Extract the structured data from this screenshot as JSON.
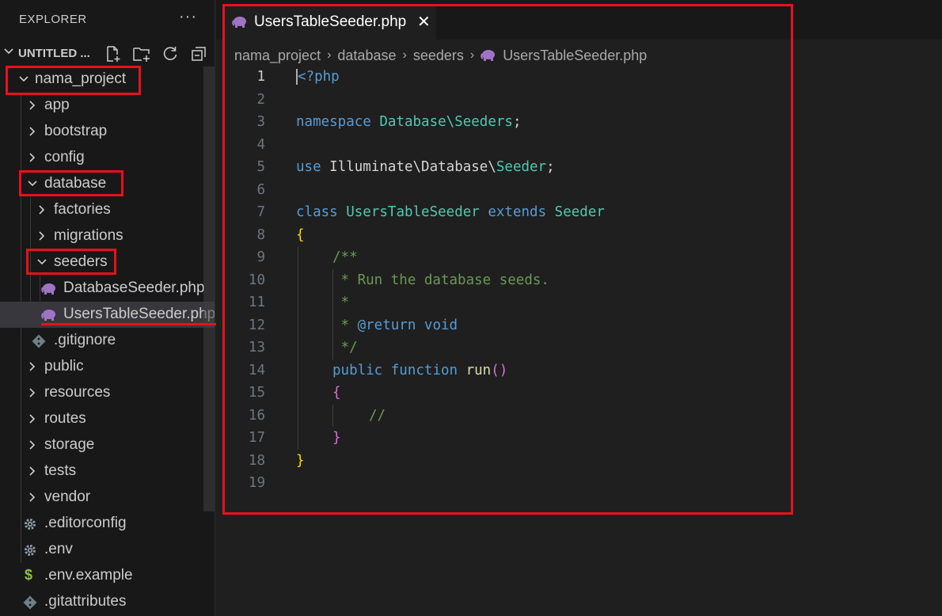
{
  "sidebar": {
    "title": "EXPLORER",
    "more_label": "···",
    "section_title": "UNTITLED ...",
    "tree": [
      {
        "label": "nama_project",
        "type": "folder",
        "expanded": true
      },
      {
        "label": "app",
        "type": "folder",
        "expanded": false
      },
      {
        "label": "bootstrap",
        "type": "folder",
        "expanded": false
      },
      {
        "label": "config",
        "type": "folder",
        "expanded": false
      },
      {
        "label": "database",
        "type": "folder",
        "expanded": true
      },
      {
        "label": "factories",
        "type": "folder",
        "expanded": false
      },
      {
        "label": "migrations",
        "type": "folder",
        "expanded": false
      },
      {
        "label": "seeders",
        "type": "folder",
        "expanded": true
      },
      {
        "label": "DatabaseSeeder.php",
        "type": "php"
      },
      {
        "label": "UsersTableSeeder.php",
        "type": "php",
        "selected": true
      },
      {
        "label": ".gitignore",
        "type": "git"
      },
      {
        "label": "public",
        "type": "folder",
        "expanded": false
      },
      {
        "label": "resources",
        "type": "folder",
        "expanded": false
      },
      {
        "label": "routes",
        "type": "folder",
        "expanded": false
      },
      {
        "label": "storage",
        "type": "folder",
        "expanded": false
      },
      {
        "label": "tests",
        "type": "folder",
        "expanded": false
      },
      {
        "label": "vendor",
        "type": "folder",
        "expanded": false
      },
      {
        "label": ".editorconfig",
        "type": "gear"
      },
      {
        "label": ".env",
        "type": "gear"
      },
      {
        "label": ".env.example",
        "type": "dollar"
      },
      {
        "label": ".gitattributes",
        "type": "git"
      }
    ]
  },
  "editor": {
    "tab_label": "UsersTableSeeder.php",
    "tab_close": "✕",
    "breadcrumb": [
      "nama_project",
      "database",
      "seeders",
      "UsersTableSeeder.php"
    ],
    "active_line": 1,
    "line_numbers": [
      "1",
      "2",
      "3",
      "4",
      "5",
      "6",
      "7",
      "8",
      "9",
      "10",
      "11",
      "12",
      "13",
      "14",
      "15",
      "16",
      "17",
      "18",
      "19"
    ],
    "code": {
      "l1_tag": "<?php",
      "l3_kw": "namespace",
      "l3_ns": "Database\\Seeders",
      "l3_end": ";",
      "l5_kw": "use",
      "l5_ns": "Illuminate\\Database\\",
      "l5_cls": "Seeder",
      "l5_end": ";",
      "l7_kw": "class",
      "l7_cls": "UsersTableSeeder",
      "l7_kw2": "extends",
      "l7_cls2": "Seeder",
      "l8": "{",
      "l9": "/**",
      "l10": " * Run the database seeds.",
      "l11": " *",
      "l12_star": " * ",
      "l12_tag": "@return",
      "l12_type": "void",
      "l13": " */",
      "l14_kw": "public",
      "l14_kw2": "function",
      "l14_fn": "run",
      "l14_parens": "()",
      "l15": "{",
      "l16": "//",
      "l17": "}",
      "l18": "}"
    }
  },
  "colors": {
    "highlight_red": "#e8111b",
    "php_icon": "#a074c4",
    "accent": "#0078d4"
  }
}
